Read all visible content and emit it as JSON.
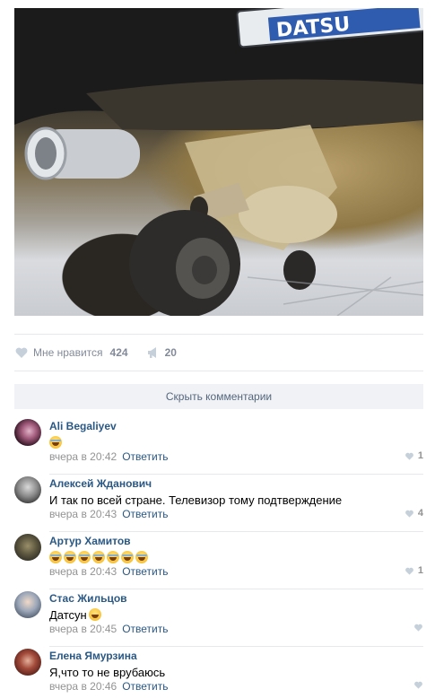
{
  "post": {
    "likes_label": "Мне нравится",
    "likes_count": "424",
    "shares_count": "20",
    "hide_comments_label": "Скрыть комментарии",
    "plate_text": "DATSU"
  },
  "comments": [
    {
      "author": "Ali Begaliyev",
      "text": "",
      "emoji_count": 1,
      "time": "вчера в 20:42",
      "reply": "Ответить",
      "likes": "1"
    },
    {
      "author": "Алексей Жданович",
      "text": "И так по всей стране. Телевизор тому подтверждение",
      "emoji_count": 0,
      "time": "вчера в 20:43",
      "reply": "Ответить",
      "likes": "4"
    },
    {
      "author": "Артур Хамитов",
      "text": "",
      "emoji_count": 7,
      "time": "вчера в 20:43",
      "reply": "Ответить",
      "likes": "1"
    },
    {
      "author": "Стас Жильцов",
      "text": "Датсун",
      "emoji_count": 1,
      "time": "вчера в 20:45",
      "reply": "Ответить",
      "likes": ""
    },
    {
      "author": "Елена Ямурзина",
      "text": "Я,что то не врубаюсь",
      "emoji_count": 0,
      "time": "вчера в 20:46",
      "reply": "Ответить",
      "likes": ""
    }
  ],
  "colors": {
    "link": "#2a5885",
    "meta": "#939393",
    "bar": "#f0f2f5"
  }
}
